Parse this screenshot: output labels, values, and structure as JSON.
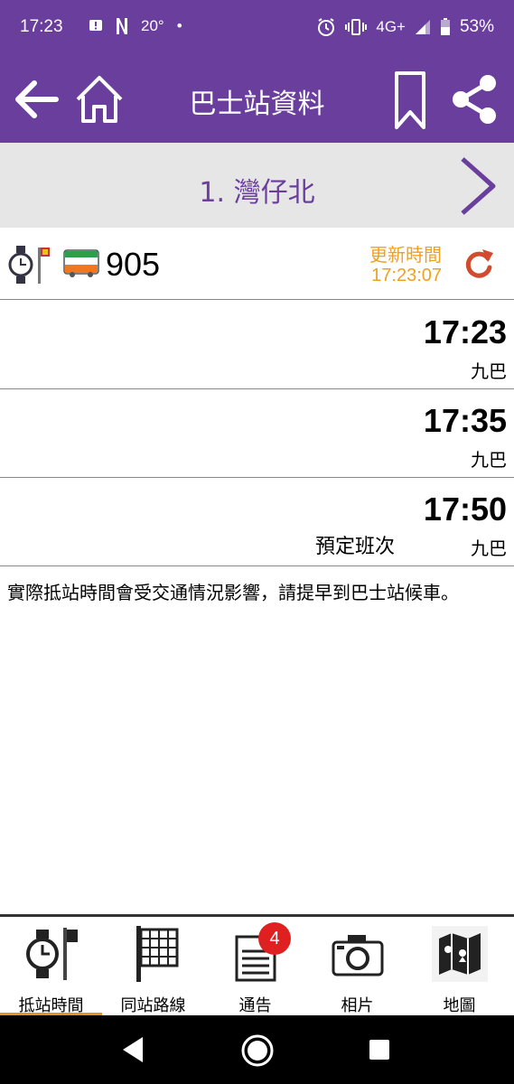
{
  "status_bar": {
    "time": "17:23",
    "notification_icons": [
      "alert-icon",
      "netflix-icon"
    ],
    "temperature": "20°",
    "dot": "•",
    "network": "4G+",
    "battery": "53%"
  },
  "app_bar": {
    "title": "巴士站資料",
    "icons": [
      "back-arrow-icon",
      "home-icon",
      "bookmark-icon",
      "share-icon"
    ],
    "background_color": "#6a3e9c"
  },
  "stop": {
    "name": "1. 灣仔北",
    "accent_color": "#6a3e9c"
  },
  "route_info": {
    "route_number": "905",
    "update_label": "更新時間",
    "update_time": "17:23:07",
    "update_color": "#f0a020",
    "refresh_color": "#d24b2e"
  },
  "etas": [
    {
      "time": "17:23",
      "operator": "九巴",
      "remark": ""
    },
    {
      "time": "17:35",
      "operator": "九巴",
      "remark": ""
    },
    {
      "time": "17:50",
      "operator": "九巴",
      "remark": "預定班次"
    }
  ],
  "notice": "實際抵站時間會受交通情況影響，請提早到巴士站候車。",
  "bottom_nav": {
    "items": [
      {
        "label": "抵站時間",
        "icon": "watch-stop-icon",
        "active": true
      },
      {
        "label": "同站路線",
        "icon": "timetable-icon",
        "active": false
      },
      {
        "label": "通告",
        "icon": "notice-icon",
        "active": false,
        "badge": "4"
      },
      {
        "label": "相片",
        "icon": "camera-icon",
        "active": false
      },
      {
        "label": "地圖",
        "icon": "map-icon",
        "active": false
      }
    ],
    "active_color": "#e8902a",
    "badge_color": "#e02020"
  }
}
